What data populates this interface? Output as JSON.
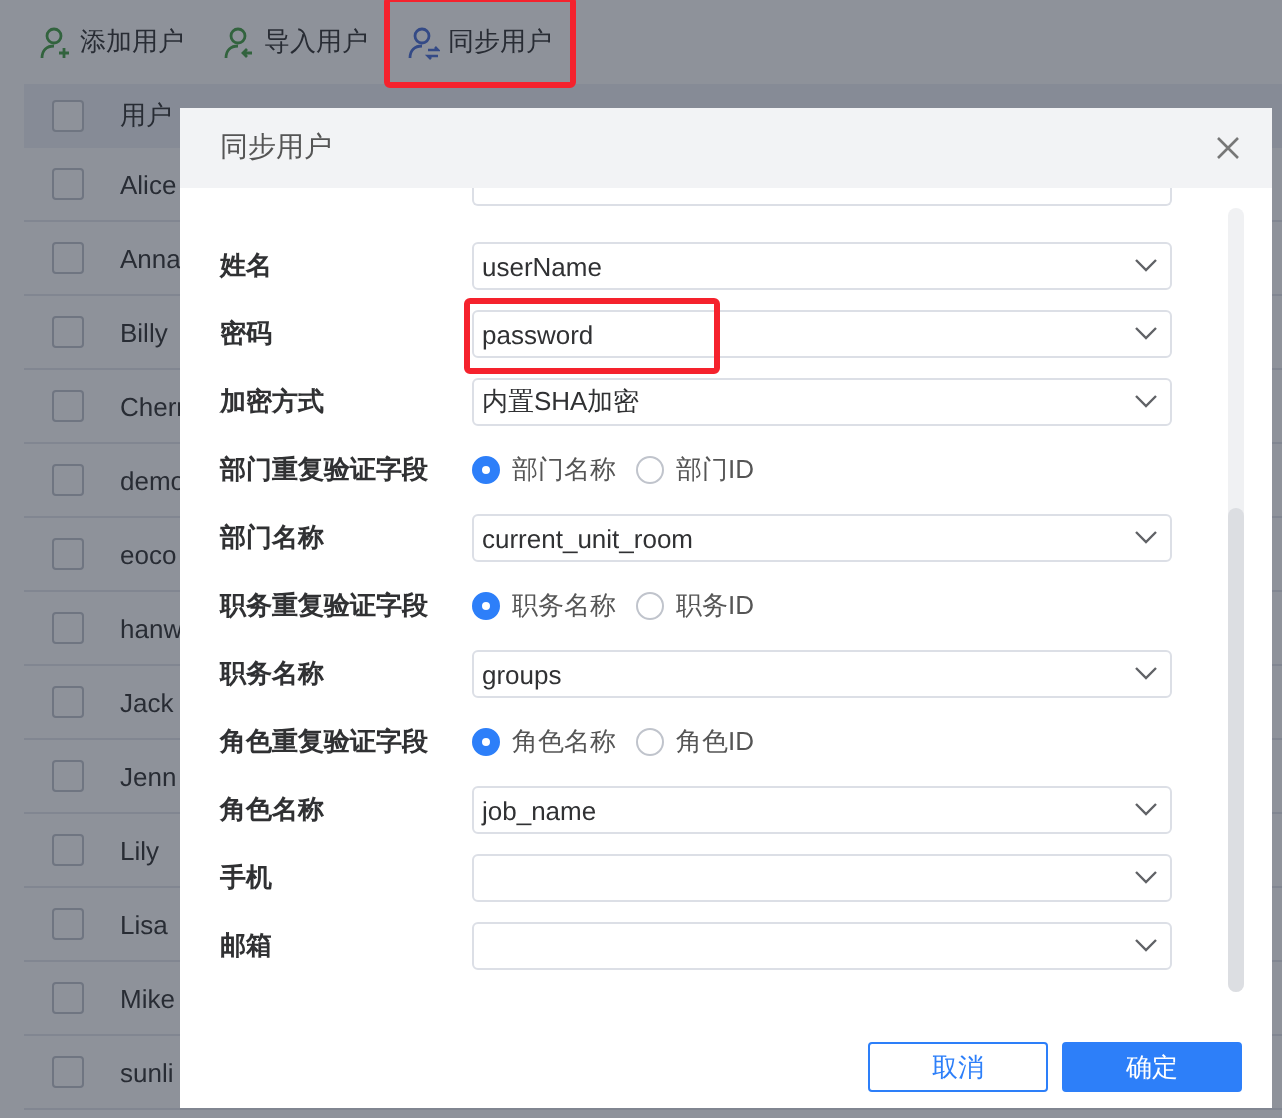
{
  "toolbar": [
    {
      "kind": "add",
      "label": "添加用户",
      "highlighted": false
    },
    {
      "kind": "import",
      "label": "导入用户",
      "highlighted": false
    },
    {
      "kind": "sync",
      "label": "同步用户",
      "highlighted": true
    }
  ],
  "table": {
    "columns": [
      "用户"
    ],
    "select_all_checked": false,
    "rows": [
      {
        "name": "Alice",
        "checked": false
      },
      {
        "name": "Anna",
        "checked": false
      },
      {
        "name": "Billy",
        "checked": false
      },
      {
        "name": "Cherr",
        "checked": false
      },
      {
        "name": "demo",
        "checked": false
      },
      {
        "name": "eoco",
        "checked": false
      },
      {
        "name": "hanw",
        "checked": false
      },
      {
        "name": "Jack",
        "checked": false
      },
      {
        "name": "Jenn",
        "checked": false
      },
      {
        "name": "Lily",
        "checked": false
      },
      {
        "name": "Lisa",
        "checked": false
      },
      {
        "name": "Mike",
        "checked": false
      },
      {
        "name": "sunli",
        "checked": false
      }
    ]
  },
  "dialog": {
    "title": "同步用户",
    "form": [
      {
        "kind": "select",
        "label": "姓名",
        "value": "userName",
        "highlighted": false
      },
      {
        "kind": "select",
        "label": "密码",
        "value": "password",
        "highlighted": true
      },
      {
        "kind": "select",
        "label": "加密方式",
        "value": "内置SHA加密",
        "highlighted": false
      },
      {
        "kind": "radio",
        "label": "部门重复验证字段",
        "options": [
          {
            "label": "部门名称",
            "selected": true
          },
          {
            "label": "部门ID",
            "selected": false
          }
        ]
      },
      {
        "kind": "select",
        "label": "部门名称",
        "value": "current_unit_room",
        "highlighted": false
      },
      {
        "kind": "radio",
        "label": "职务重复验证字段",
        "options": [
          {
            "label": "职务名称",
            "selected": true
          },
          {
            "label": "职务ID",
            "selected": false
          }
        ]
      },
      {
        "kind": "select",
        "label": "职务名称",
        "value": "groups",
        "highlighted": false
      },
      {
        "kind": "radio",
        "label": "角色重复验证字段",
        "options": [
          {
            "label": "角色名称",
            "selected": true
          },
          {
            "label": "角色ID",
            "selected": false
          }
        ]
      },
      {
        "kind": "select",
        "label": "角色名称",
        "value": "job_name",
        "highlighted": false
      },
      {
        "kind": "select",
        "label": "手机",
        "highlighted": false
      },
      {
        "kind": "select",
        "label": "邮箱",
        "highlighted": false
      }
    ],
    "buttons": [
      {
        "kind": "secondary",
        "label": "取消"
      },
      {
        "kind": "primary",
        "label": "确定"
      }
    ]
  }
}
